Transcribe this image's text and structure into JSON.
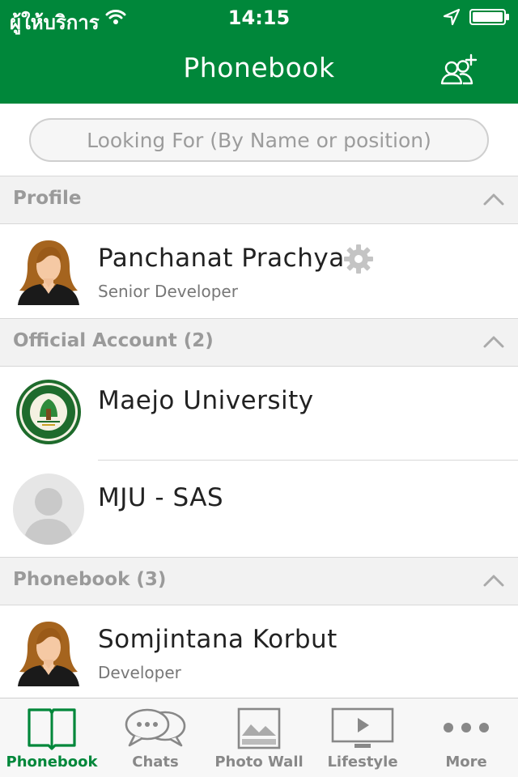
{
  "status_bar": {
    "carrier": "ผู้ให้บริการ",
    "time": "14:15"
  },
  "header": {
    "title": "Phonebook",
    "add_icon": "add-contact-icon"
  },
  "search": {
    "placeholder": "Looking For (By Name or position)"
  },
  "sections": {
    "profile": {
      "title": "Profile",
      "items": [
        {
          "name": "Panchanat Prachya",
          "subtitle": "Senior Developer",
          "avatar": "female-avatar",
          "settings_icon": "gear-icon"
        }
      ]
    },
    "official": {
      "title": "Official Account (2)",
      "items": [
        {
          "name": "Maejo University",
          "avatar": "university-seal"
        },
        {
          "name": "MJU - SAS",
          "avatar": "default-avatar"
        }
      ]
    },
    "phonebook": {
      "title": "Phonebook (3)",
      "items": [
        {
          "name": "Somjintana Korbut",
          "subtitle": "Developer",
          "avatar": "female-avatar"
        }
      ]
    }
  },
  "tabs": [
    {
      "label": "Phonebook",
      "icon": "book-icon",
      "active": true
    },
    {
      "label": "Chats",
      "icon": "chat-bubbles-icon",
      "active": false
    },
    {
      "label": "Photo Wall",
      "icon": "photo-icon",
      "active": false
    },
    {
      "label": "Lifestyle",
      "icon": "tv-play-icon",
      "active": false
    },
    {
      "label": "More",
      "icon": "more-dots-icon",
      "active": false
    }
  ],
  "colors": {
    "brand_green": "#00873a",
    "section_bg": "#f2f2f2",
    "muted_text": "#9a9a9a"
  }
}
